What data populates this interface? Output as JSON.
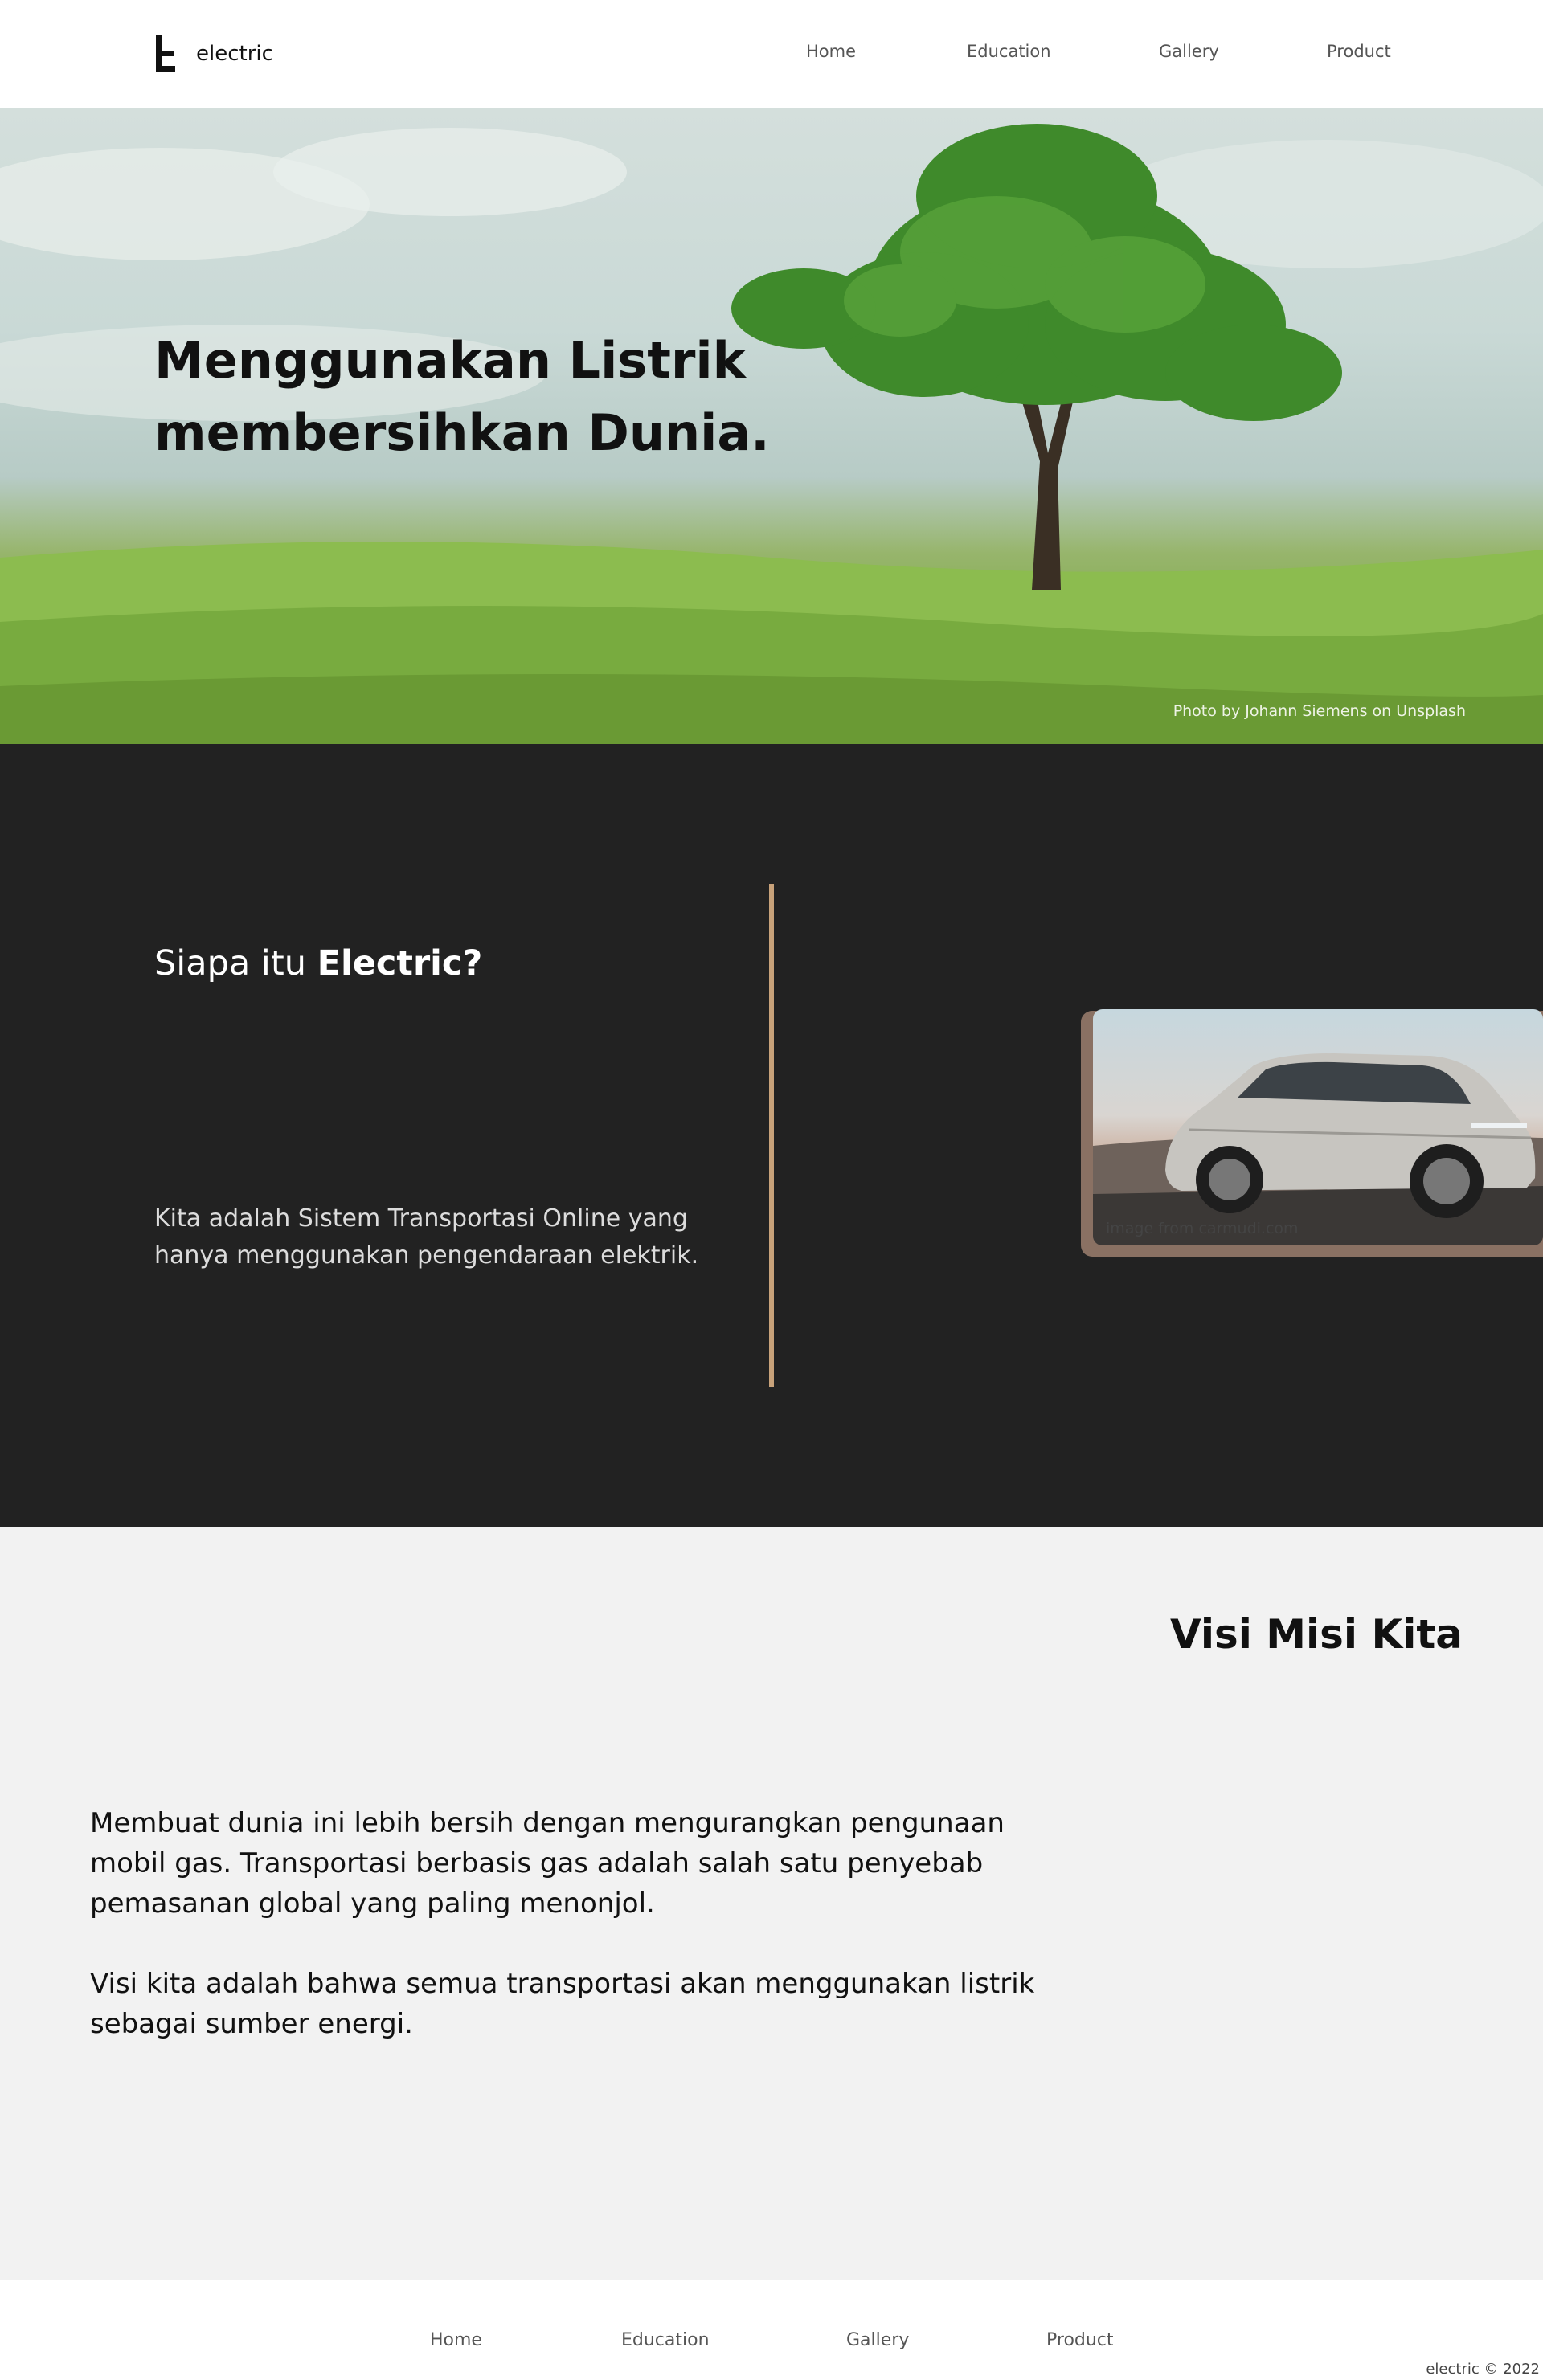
{
  "header": {
    "brand": "electric",
    "nav": [
      "Home",
      "Education",
      "Gallery",
      "Product"
    ]
  },
  "hero": {
    "title_line1": "Menggunakan Listrik",
    "title_line2": "membersihkan Dunia.",
    "credit": "Photo by Johann Siemens on Unsplash"
  },
  "about": {
    "heading_prefix": "Siapa itu ",
    "heading_bold": "Electric?",
    "text": "Kita adalah Sistem Transportasi Online yang hanya menggunakan pengendaraan elektrik.",
    "image_credit": "image from carmudi.com"
  },
  "vision": {
    "title": "Visi Misi Kita",
    "paragraph1": "Membuat dunia ini lebih bersih dengan mengurangkan pengunaan mobil gas. Transportasi berbasis gas adalah salah satu penyebab pemasanan global yang paling menonjol.",
    "paragraph2": "Visi kita adalah bahwa semua transportasi akan menggunakan listrik sebagai sumber energi."
  },
  "footer": {
    "nav": [
      "Home",
      "Education",
      "Gallery",
      "Product"
    ],
    "copyright": "electric © 2022"
  },
  "colors": {
    "dark_bg": "#222222",
    "accent": "#c8a27a",
    "light_bg": "#f2f2f2"
  }
}
